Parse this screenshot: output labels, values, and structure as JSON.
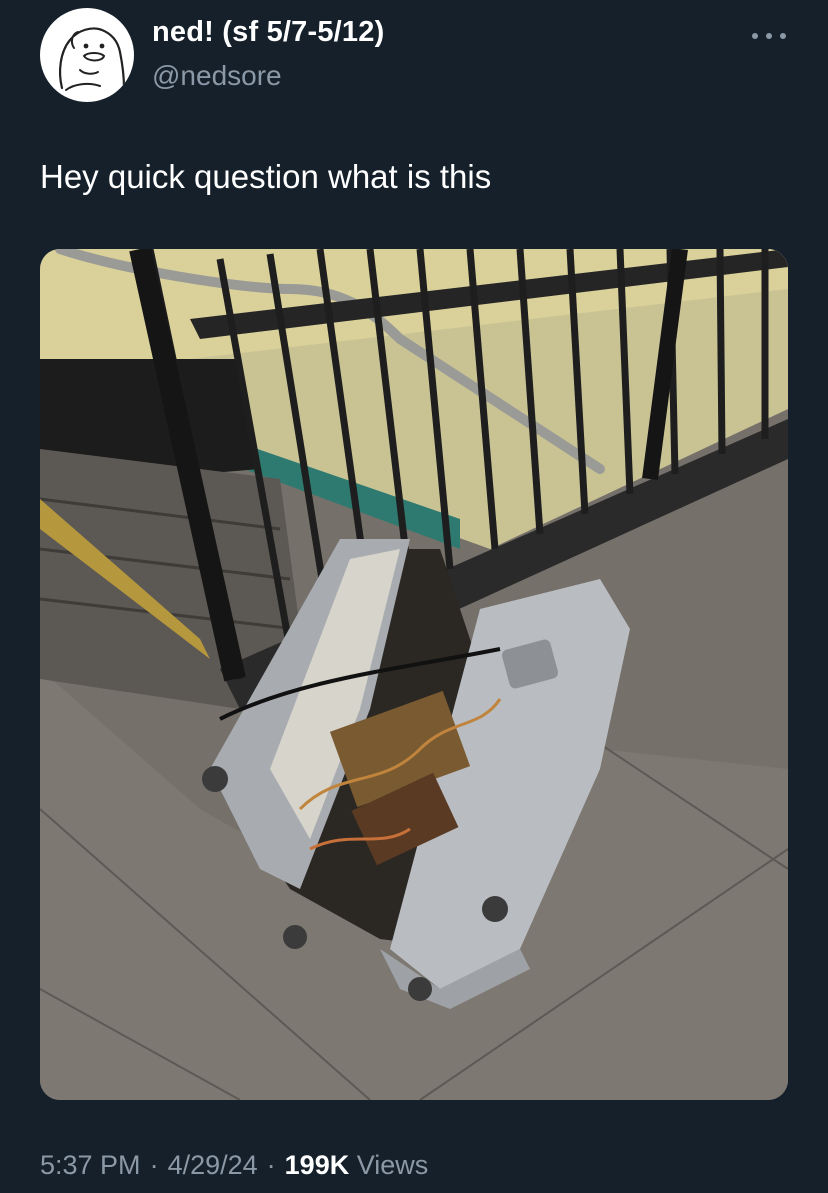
{
  "author": {
    "display_name": "ned! (sf 5/7-5/12)",
    "handle": "@nedsore",
    "avatar_icon": "duck-sketch-avatar-icon"
  },
  "tweet": {
    "text": "Hey quick question what is this"
  },
  "media": {
    "description_icon": "photo-broken-suitcase-subway-icon"
  },
  "meta": {
    "time": "5:37 PM",
    "separator": "·",
    "date": "4/29/24",
    "views_count": "199K",
    "views_label": "Views"
  },
  "colors": {
    "background": "#15202b",
    "text_primary": "#ffffff",
    "text_secondary": "#8b98a5"
  }
}
